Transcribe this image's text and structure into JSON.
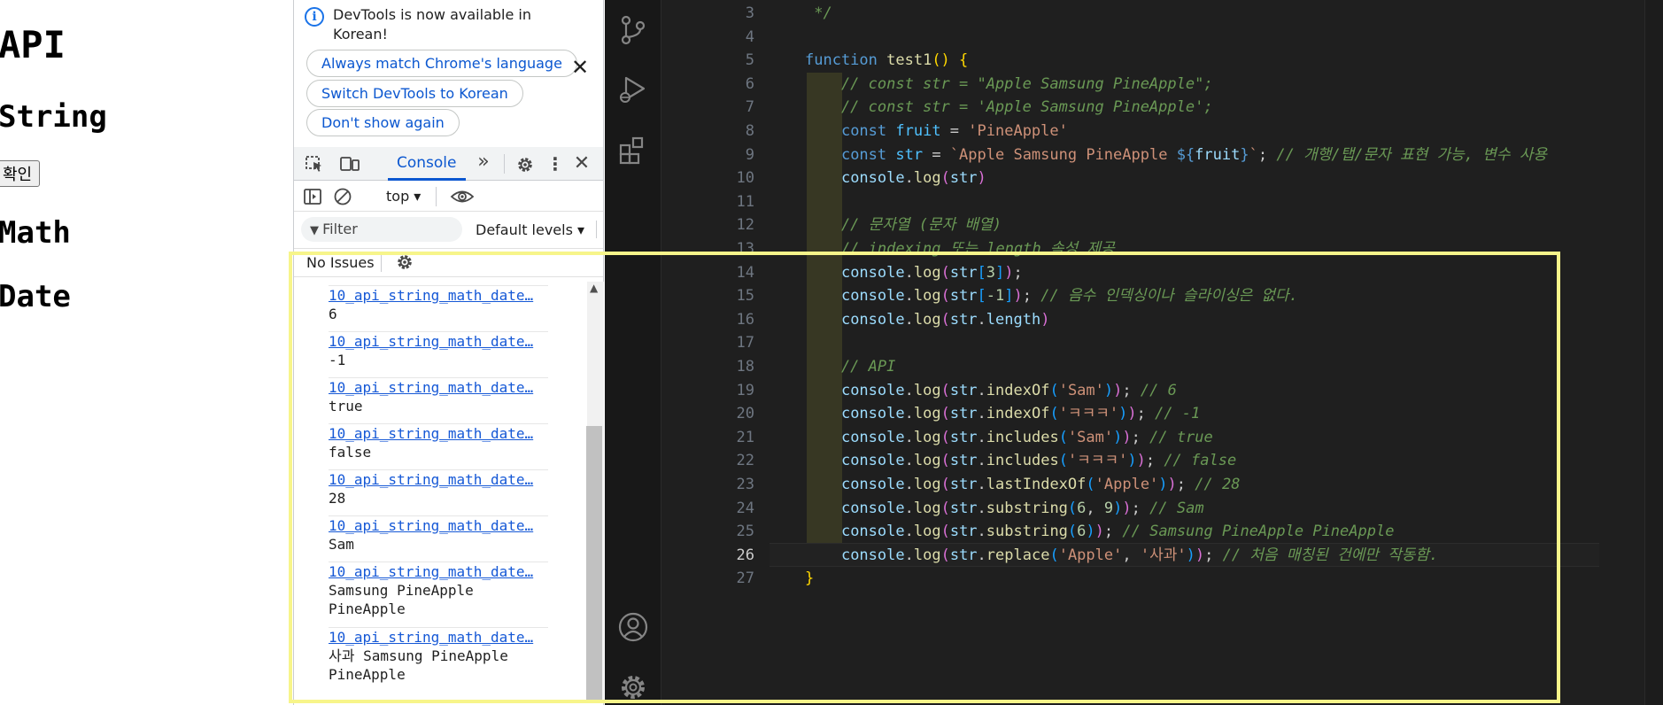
{
  "preview": {
    "title": "API",
    "string_heading": "String",
    "confirm_button": "확인",
    "math_heading": "Math",
    "date_heading": "Date"
  },
  "devtools": {
    "infobar": {
      "message": "DevTools is now available in Korean!",
      "match_language": "Always match Chrome's language",
      "switch_language": "Switch DevTools to Korean",
      "dont_show": "Don't show again",
      "close": "✕"
    },
    "tabs": {
      "console": "Console"
    },
    "toolbar": {
      "context": "top ▾"
    },
    "filter": {
      "placeholder": "Filter",
      "levels": "Default levels ▾"
    },
    "issues": {
      "label": "No Issues"
    },
    "log": [
      {
        "source": "10_api_string_math_date…",
        "value": "6"
      },
      {
        "source": "10_api_string_math_date…",
        "value": "-1"
      },
      {
        "source": "10_api_string_math_date…",
        "value": "true"
      },
      {
        "source": "10_api_string_math_date…",
        "value": "false"
      },
      {
        "source": "10_api_string_math_date…",
        "value": "28"
      },
      {
        "source": "10_api_string_math_date…",
        "value": "Sam"
      },
      {
        "source": "10_api_string_math_date…",
        "value": "Samsung PineApple\nPineApple"
      },
      {
        "source": "10_api_string_math_date…",
        "value": "사과 Samsung PineApple\nPineApple"
      }
    ]
  },
  "editor": {
    "active_line": 26,
    "line_numbers": [
      3,
      4,
      5,
      6,
      7,
      8,
      9,
      10,
      11,
      12,
      13,
      14,
      15,
      16,
      17,
      18,
      19,
      20,
      21,
      22,
      23,
      24,
      25,
      26,
      27
    ],
    "lines": [
      [
        [
          "cmt",
          " */"
        ]
      ],
      [],
      [
        [
          "kw",
          "function "
        ],
        [
          "fn",
          "test1"
        ],
        [
          "br1",
          "() {"
        ]
      ],
      [
        [
          "cmt",
          "    // const str = \"Apple Samsung PineApple\";"
        ]
      ],
      [
        [
          "cmt",
          "    // const str = 'Apple Samsung PineApple';"
        ]
      ],
      [
        [
          "",
          "    "
        ],
        [
          "kw",
          "const "
        ],
        [
          "cst",
          "fruit"
        ],
        [
          "",
          " = "
        ],
        [
          "str",
          "'PineApple'"
        ]
      ],
      [
        [
          "",
          "    "
        ],
        [
          "kw",
          "const "
        ],
        [
          "cst",
          "str"
        ],
        [
          "",
          " = "
        ],
        [
          "str",
          "`Apple Samsung PineApple "
        ],
        [
          "tpl",
          "${"
        ],
        [
          "var",
          "fruit"
        ],
        [
          "tpl",
          "}"
        ],
        [
          "str",
          "`"
        ],
        [
          "",
          "; "
        ],
        [
          "cmt",
          "// 개행/탭/문자 표현 가능, 변수 사용"
        ]
      ],
      [
        [
          "",
          "    "
        ],
        [
          "var",
          "console"
        ],
        [
          "",
          "."
        ],
        [
          "fn",
          "log"
        ],
        [
          "br2",
          "("
        ],
        [
          "var",
          "str"
        ],
        [
          "br2",
          ")"
        ]
      ],
      [],
      [
        [
          "cmt",
          "    // 문자열 (문자 배열)"
        ]
      ],
      [
        [
          "cmt",
          "    // indexing 또는 length 속성 제공"
        ]
      ],
      [
        [
          "",
          "    "
        ],
        [
          "var",
          "console"
        ],
        [
          "",
          "."
        ],
        [
          "fn",
          "log"
        ],
        [
          "br2",
          "("
        ],
        [
          "var",
          "str"
        ],
        [
          "br3",
          "["
        ],
        [
          "num",
          "3"
        ],
        [
          "br3",
          "]"
        ],
        [
          "br2",
          ")"
        ],
        [
          "",
          ";"
        ]
      ],
      [
        [
          "",
          "    "
        ],
        [
          "var",
          "console"
        ],
        [
          "",
          "."
        ],
        [
          "fn",
          "log"
        ],
        [
          "br2",
          "("
        ],
        [
          "var",
          "str"
        ],
        [
          "br3",
          "["
        ],
        [
          "num",
          "-1"
        ],
        [
          "br3",
          "]"
        ],
        [
          "br2",
          ")"
        ],
        [
          "",
          "; "
        ],
        [
          "cmt",
          "// 음수 인덱싱이나 슬라이싱은 없다."
        ]
      ],
      [
        [
          "",
          "    "
        ],
        [
          "var",
          "console"
        ],
        [
          "",
          "."
        ],
        [
          "fn",
          "log"
        ],
        [
          "br2",
          "("
        ],
        [
          "var",
          "str"
        ],
        [
          "",
          "."
        ],
        [
          "var",
          "length"
        ],
        [
          "br2",
          ")"
        ]
      ],
      [],
      [
        [
          "cmt",
          "    // API"
        ]
      ],
      [
        [
          "",
          "    "
        ],
        [
          "var",
          "console"
        ],
        [
          "",
          "."
        ],
        [
          "fn",
          "log"
        ],
        [
          "br2",
          "("
        ],
        [
          "var",
          "str"
        ],
        [
          "",
          "."
        ],
        [
          "fn",
          "indexOf"
        ],
        [
          "br3",
          "("
        ],
        [
          "str",
          "'Sam'"
        ],
        [
          "br3",
          ")"
        ],
        [
          "br2",
          ")"
        ],
        [
          "",
          "; "
        ],
        [
          "cmt",
          "// 6"
        ]
      ],
      [
        [
          "",
          "    "
        ],
        [
          "var",
          "console"
        ],
        [
          "",
          "."
        ],
        [
          "fn",
          "log"
        ],
        [
          "br2",
          "("
        ],
        [
          "var",
          "str"
        ],
        [
          "",
          "."
        ],
        [
          "fn",
          "indexOf"
        ],
        [
          "br3",
          "("
        ],
        [
          "str",
          "'ㅋㅋㅋ'"
        ],
        [
          "br3",
          ")"
        ],
        [
          "br2",
          ")"
        ],
        [
          "",
          "; "
        ],
        [
          "cmt",
          "// -1"
        ]
      ],
      [
        [
          "",
          "    "
        ],
        [
          "var",
          "console"
        ],
        [
          "",
          "."
        ],
        [
          "fn",
          "log"
        ],
        [
          "br2",
          "("
        ],
        [
          "var",
          "str"
        ],
        [
          "",
          "."
        ],
        [
          "fn",
          "includes"
        ],
        [
          "br3",
          "("
        ],
        [
          "str",
          "'Sam'"
        ],
        [
          "br3",
          ")"
        ],
        [
          "br2",
          ")"
        ],
        [
          "",
          "; "
        ],
        [
          "cmt",
          "// true"
        ]
      ],
      [
        [
          "",
          "    "
        ],
        [
          "var",
          "console"
        ],
        [
          "",
          "."
        ],
        [
          "fn",
          "log"
        ],
        [
          "br2",
          "("
        ],
        [
          "var",
          "str"
        ],
        [
          "",
          "."
        ],
        [
          "fn",
          "includes"
        ],
        [
          "br3",
          "("
        ],
        [
          "str",
          "'ㅋㅋㅋ'"
        ],
        [
          "br3",
          ")"
        ],
        [
          "br2",
          ")"
        ],
        [
          "",
          "; "
        ],
        [
          "cmt",
          "// false"
        ]
      ],
      [
        [
          "",
          "    "
        ],
        [
          "var",
          "console"
        ],
        [
          "",
          "."
        ],
        [
          "fn",
          "log"
        ],
        [
          "br2",
          "("
        ],
        [
          "var",
          "str"
        ],
        [
          "",
          "."
        ],
        [
          "fn",
          "lastIndexOf"
        ],
        [
          "br3",
          "("
        ],
        [
          "str",
          "'Apple'"
        ],
        [
          "br3",
          ")"
        ],
        [
          "br2",
          ")"
        ],
        [
          "",
          "; "
        ],
        [
          "cmt",
          "// 28"
        ]
      ],
      [
        [
          "",
          "    "
        ],
        [
          "var",
          "console"
        ],
        [
          "",
          "."
        ],
        [
          "fn",
          "log"
        ],
        [
          "br2",
          "("
        ],
        [
          "var",
          "str"
        ],
        [
          "",
          "."
        ],
        [
          "fn",
          "substring"
        ],
        [
          "br3",
          "("
        ],
        [
          "num",
          "6"
        ],
        [
          "",
          ", "
        ],
        [
          "num",
          "9"
        ],
        [
          "br3",
          ")"
        ],
        [
          "br2",
          ")"
        ],
        [
          "",
          "; "
        ],
        [
          "cmt",
          "// Sam"
        ]
      ],
      [
        [
          "",
          "    "
        ],
        [
          "var",
          "console"
        ],
        [
          "",
          "."
        ],
        [
          "fn",
          "log"
        ],
        [
          "br2",
          "("
        ],
        [
          "var",
          "str"
        ],
        [
          "",
          "."
        ],
        [
          "fn",
          "substring"
        ],
        [
          "br3",
          "("
        ],
        [
          "num",
          "6"
        ],
        [
          "br3",
          ")"
        ],
        [
          "br2",
          ")"
        ],
        [
          "",
          "; "
        ],
        [
          "cmt",
          "// Samsung PineApple PineApple"
        ]
      ],
      [
        [
          "",
          "    "
        ],
        [
          "var",
          "console"
        ],
        [
          "",
          "."
        ],
        [
          "fn",
          "log"
        ],
        [
          "br2",
          "("
        ],
        [
          "var",
          "str"
        ],
        [
          "",
          "."
        ],
        [
          "fn",
          "replace"
        ],
        [
          "br3",
          "("
        ],
        [
          "str",
          "'Apple'"
        ],
        [
          "",
          ", "
        ],
        [
          "str",
          "'사과'"
        ],
        [
          "br3",
          ")"
        ],
        [
          "br2",
          ")"
        ],
        [
          "",
          "; "
        ],
        [
          "cmt",
          "// 처음 매칭된 건에만 작동함."
        ]
      ],
      [
        [
          "br1",
          "}"
        ]
      ]
    ]
  },
  "colors": {
    "highlight": "#f7f58a",
    "devtools_accent": "#0b57d0",
    "editor_bg": "#1f1f1f"
  },
  "icons": {
    "devtools_toolbar": [
      "inspect-element-icon",
      "device-toolbar-icon",
      "more-tabs-icon",
      "settings-icon",
      "kebab-menu-icon",
      "close-icon"
    ],
    "console_toolbar": [
      "sidebar-toggle-icon",
      "clear-console-icon",
      "live-expression-eye-icon"
    ],
    "activity_bar": [
      "source-control-icon",
      "run-debug-icon",
      "extensions-icon",
      "accounts-icon",
      "manage-gear-icon"
    ]
  }
}
